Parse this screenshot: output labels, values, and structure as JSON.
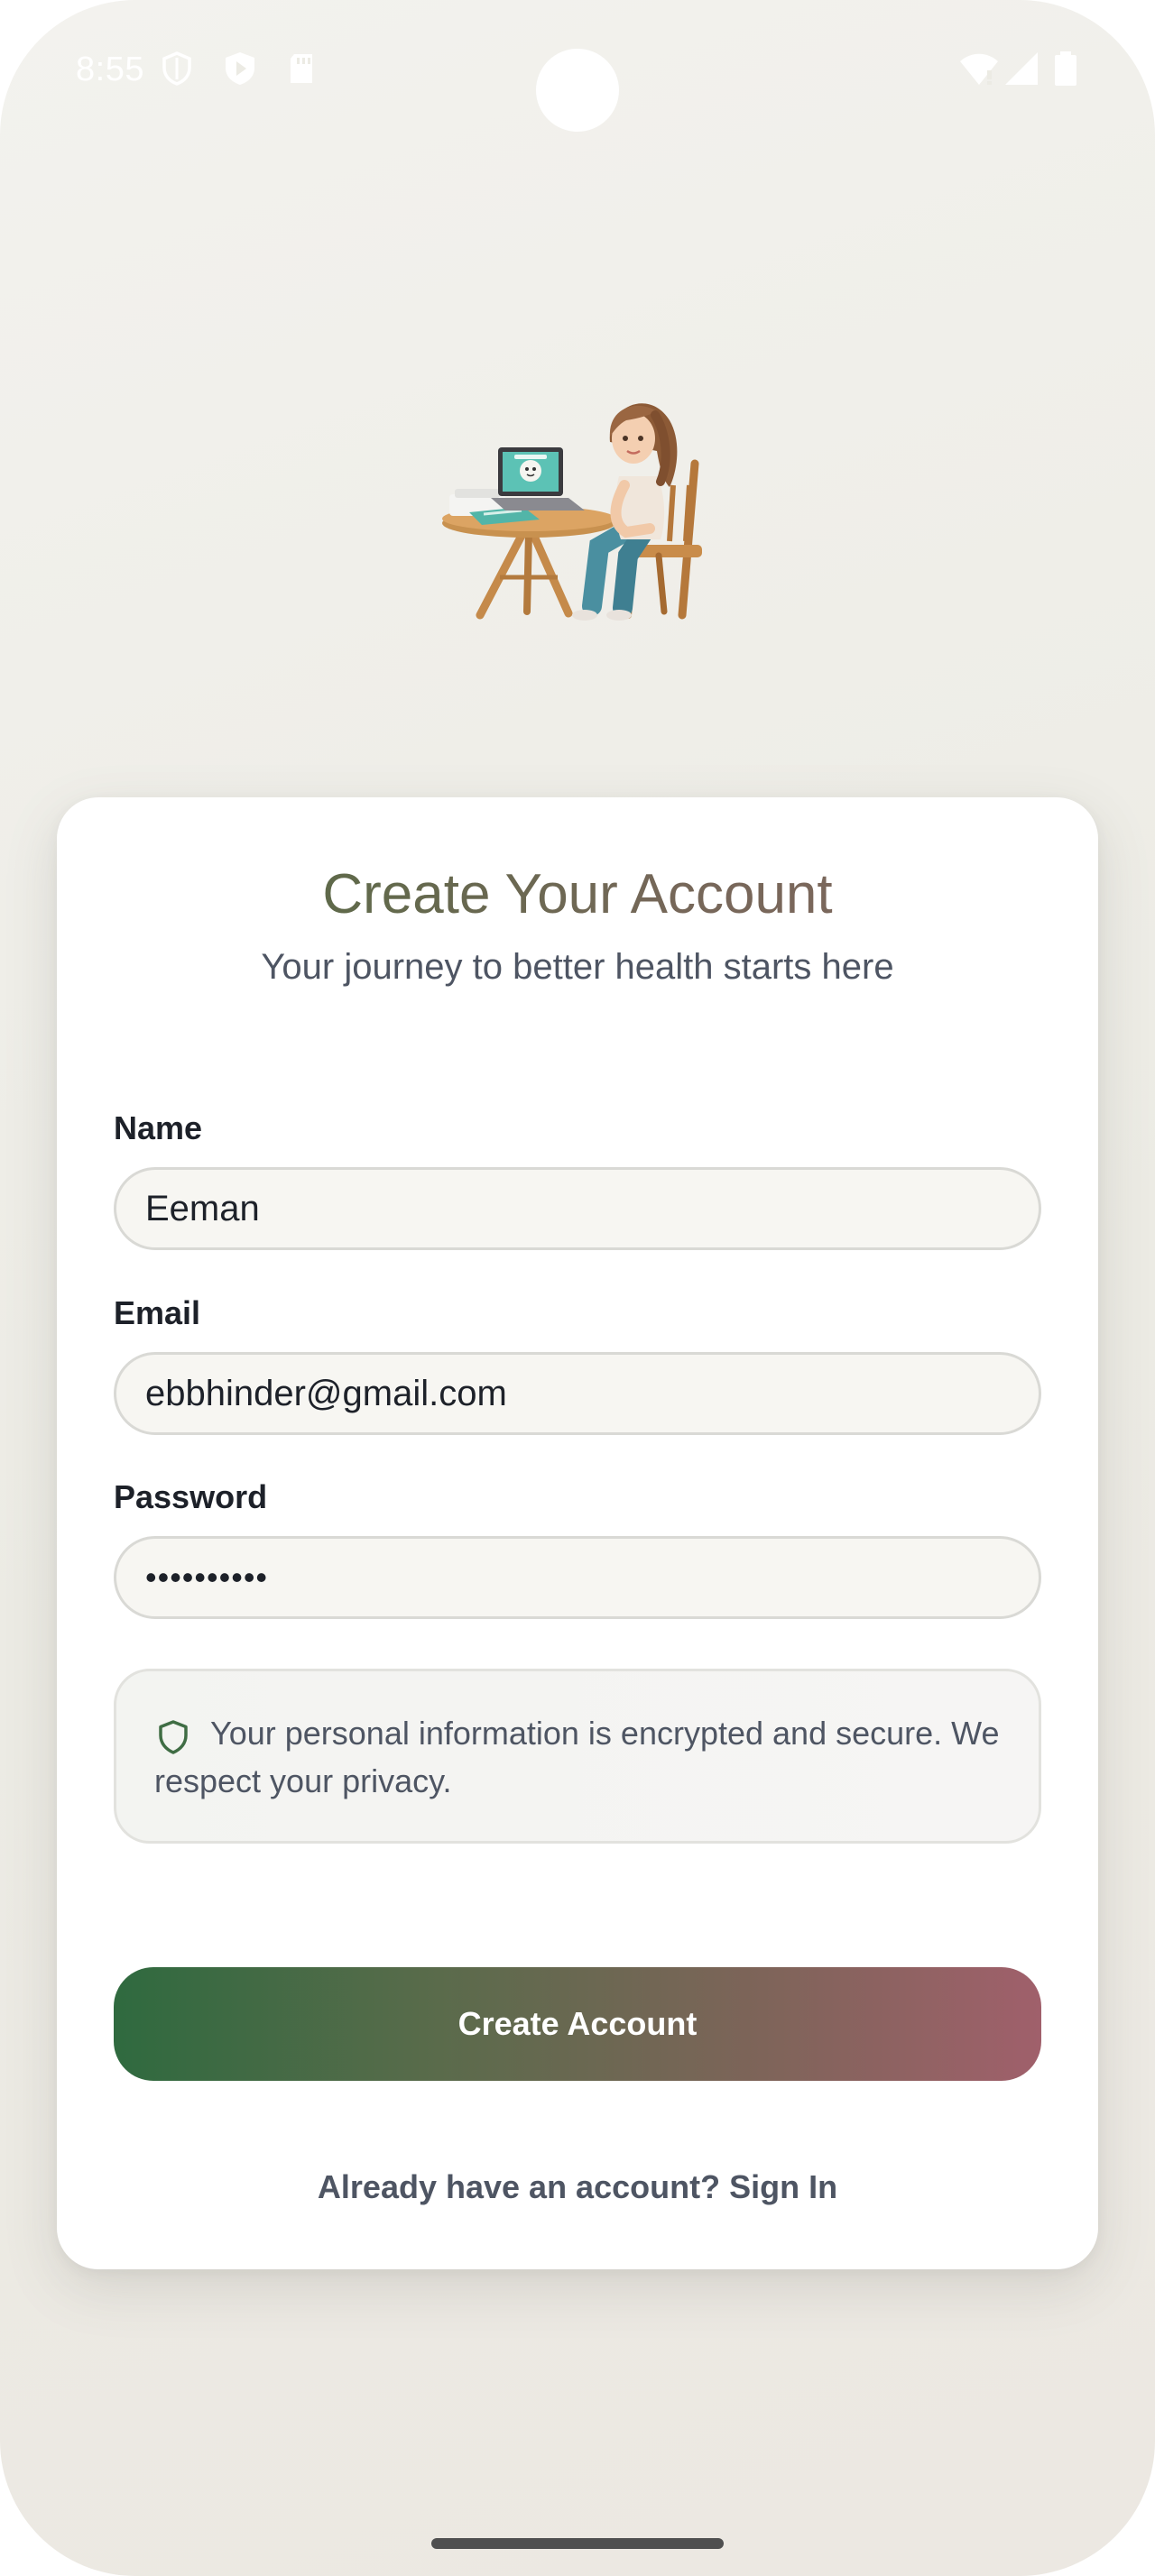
{
  "status_bar": {
    "time": "8:55",
    "left_icons": [
      "shield-status-icon",
      "play-protect-icon",
      "sd-card-icon"
    ],
    "right_icons": [
      "wifi-icon",
      "signal-icon",
      "battery-icon"
    ]
  },
  "illustration": {
    "icon": "woman-at-laptop-illustration"
  },
  "card": {
    "title": "Create Your Account",
    "subtitle": "Your journey to better health starts here"
  },
  "form": {
    "name": {
      "label": "Name",
      "value": "Eeman"
    },
    "email": {
      "label": "Email",
      "value": "ebbhinder@gmail.com"
    },
    "password": {
      "label": "Password",
      "value": "••••••••••"
    }
  },
  "privacy": {
    "icon": "shield-icon",
    "text": "Your personal information is encrypted and secure. We respect your privacy."
  },
  "actions": {
    "create_account": "Create Account",
    "sign_in": "Already have an account? Sign In"
  },
  "colors": {
    "button_gradient_start": "#2f6a3f",
    "button_gradient_end": "#a0606b",
    "title_green": "#4d6b3e",
    "title_mauve": "#836860",
    "shield_green": "#3f6d44"
  }
}
